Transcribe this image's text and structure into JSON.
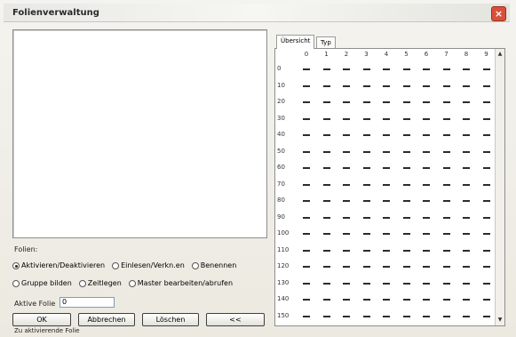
{
  "window": {
    "title": "Folienverwaltung",
    "close_symbol": "×"
  },
  "list": {
    "label": "Folien:",
    "value": ""
  },
  "options": {
    "row1": [
      "Aktivieren/Deaktivieren",
      "Einlesen/Verkn.en",
      "Benennen"
    ],
    "row2": [
      "Gruppe bilden",
      "Zeitlegen",
      "Master bearbeiten/abrufen"
    ],
    "selected": "Aktivieren/Deaktivieren"
  },
  "active_field": {
    "label": "Aktive Folie",
    "value": "0"
  },
  "buttons": {
    "ok": "OK",
    "cancel": "Abbrechen",
    "delete": "Löschen",
    "back": "<<"
  },
  "status": "Zu aktivierende Folie",
  "tabs": [
    "Übersicht",
    "Typ"
  ],
  "grid": {
    "columns": [
      "0",
      "1",
      "2",
      "3",
      "4",
      "5",
      "6",
      "7",
      "8",
      "9"
    ],
    "rows": [
      "0",
      "10",
      "20",
      "30",
      "40",
      "50",
      "60",
      "70",
      "80",
      "90",
      "100",
      "110",
      "120",
      "130",
      "140",
      "150"
    ]
  }
}
